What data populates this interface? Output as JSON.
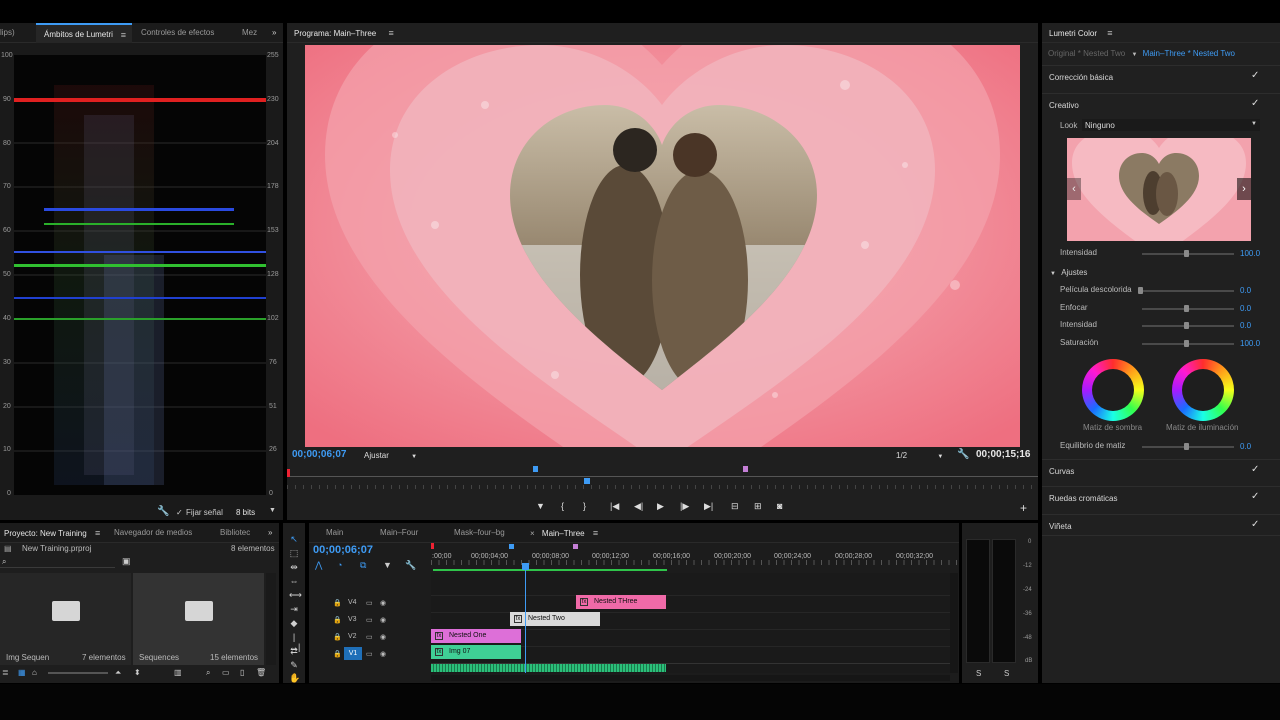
{
  "scopes": {
    "tabs": [
      {
        "label": "lips)"
      },
      {
        "label": "Ámbitos de Lumetri"
      },
      {
        "label": "Controles de efectos"
      },
      {
        "label": "Mez"
      }
    ],
    "left_scale": [
      "100",
      "90",
      "80",
      "70",
      "60",
      "50",
      "40",
      "30",
      "20",
      "10",
      "0"
    ],
    "right_scale": [
      "255",
      "230",
      "204",
      "178",
      "153",
      "128",
      "102",
      "76",
      "51",
      "26",
      "0"
    ],
    "clamp_label": "Fijar señal",
    "bits_value": "8 bits"
  },
  "program": {
    "title": "Programa: Main–Three",
    "timecode_in": "00;00;06;07",
    "fit_value": "Ajustar",
    "resolution_value": "1/2",
    "timecode_duration": "00;00;15;16"
  },
  "lumetri": {
    "title": "Lumetri Color",
    "source_clip": "Original * Nested Two",
    "active_clip": "Main–Three * Nested Two",
    "sections": {
      "basic": "Corrección básica",
      "creative": "Creativo",
      "curves": "Curvas",
      "wheels": "Ruedas cromáticas",
      "vignette": "Viñeta"
    },
    "look_label": "Look",
    "look_value": "Ninguno",
    "intensity_label": "Intensidad",
    "intensity_value": "100.0",
    "adjustments_label": "Ajustes",
    "adjustments": [
      {
        "label": "Película descolorida",
        "value": "0.0",
        "level": 0.0
      },
      {
        "label": "Enfocar",
        "value": "0.0",
        "level": 0.5
      },
      {
        "label": "Intensidad",
        "value": "0.0",
        "level": 0.5
      },
      {
        "label": "Saturación",
        "value": "100.0",
        "level": 0.5
      }
    ],
    "shadow_tint_label": "Matiz de sombra",
    "highlight_tint_label": "Matiz de iluminación",
    "tint_balance_label": "Equilibrio de matiz",
    "tint_balance_value": "0.0"
  },
  "project": {
    "tabs": [
      {
        "label": "Proyecto: New Training"
      },
      {
        "label": "Navegador de medios"
      },
      {
        "label": "Bibliotec"
      }
    ],
    "file_name": "New Training.prproj",
    "item_count": "8 elementos",
    "bins": [
      {
        "name": "Img Sequen",
        "count": "7 elementos"
      },
      {
        "name": "Sequences",
        "count": "15 elementos"
      }
    ]
  },
  "timeline": {
    "tabs": [
      {
        "label": "Main"
      },
      {
        "label": "Main–Four"
      },
      {
        "label": "Mask–four–bg"
      },
      {
        "label": "Main–Three"
      }
    ],
    "timecode": "00;00;06;07",
    "ruler": [
      ":00;00",
      "00;00;04;00",
      "00;00;08;00",
      "00;00;12;00",
      "00;00;16;00",
      "00;00;20;00",
      "00;00;24;00",
      "00;00;28;00",
      "00;00;32;00"
    ],
    "tracks": [
      {
        "name": "V4"
      },
      {
        "name": "V3"
      },
      {
        "name": "V2"
      },
      {
        "name": "V1"
      }
    ],
    "clips": [
      {
        "name": "Nested THree",
        "color": "#f06aa8"
      },
      {
        "name": "Nested Two",
        "color": "#d9d9d9"
      },
      {
        "name": "Nested One",
        "color": "#dd6fd8"
      },
      {
        "name": "Img 07",
        "color": "#3fcf95"
      }
    ]
  },
  "meter": {
    "scale": [
      "0",
      "-12",
      "-24",
      "-36",
      "-48",
      "dB"
    ],
    "solo_left": "S",
    "solo_right": "S"
  },
  "colors": {
    "accent_blue": "#3e9bf4",
    "panel_bg": "#1e1e1e",
    "pink_bg": "#f29aa6"
  }
}
